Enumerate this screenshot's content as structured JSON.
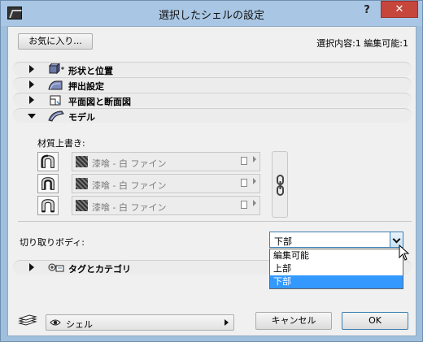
{
  "window": {
    "title": "選択したシェルの設定",
    "help_label": "?",
    "close_label": "✕"
  },
  "toolbar": {
    "favorites_label": "お気に入り...",
    "selection_info": "選択内容:1 編集可能:1"
  },
  "sections": {
    "shape": {
      "label": "形状と位置",
      "icon": "shape-position-icon"
    },
    "extrude": {
      "label": "押出設定",
      "icon": "extrude-icon"
    },
    "plan": {
      "label": "平面図と断面図",
      "icon": "plan-section-icon"
    },
    "model": {
      "label": "モデル",
      "icon": "model-shell-icon"
    },
    "tags": {
      "label": "タグとカテゴリ",
      "icon": "tag-category-icon"
    }
  },
  "model": {
    "override_label": "材質上書き:",
    "materials": [
      {
        "name": "漆喰 - 白 ファイン",
        "icon": "surface-outer-icon"
      },
      {
        "name": "漆喰 - 白 ファイン",
        "icon": "surface-inner-icon"
      },
      {
        "name": "漆喰 - 白 ファイン",
        "icon": "surface-edge-icon"
      }
    ],
    "link_icon": "chain-link-icon"
  },
  "cut_body": {
    "label": "切り取りボディ:",
    "selected": "下部",
    "options": [
      "編集可能",
      "上部",
      "下部"
    ],
    "highlighted_index": 2
  },
  "footer": {
    "layer_icon": "layers-icon",
    "view_label": "シェル",
    "cancel_label": "キャンセル",
    "ok_label": "OK"
  },
  "colors": {
    "title_bar": "#a9c7e4",
    "close_button": "#c7463c",
    "highlight": "#3399ff",
    "focus_border": "#3c7fb1"
  }
}
